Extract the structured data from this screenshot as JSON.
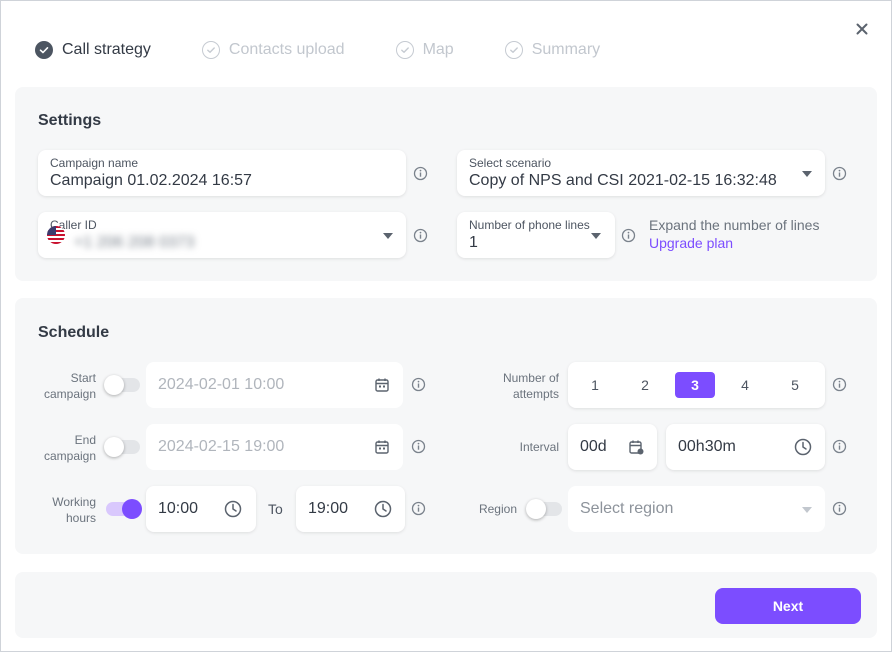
{
  "stepper": {
    "steps": [
      {
        "label": "Call strategy",
        "state": "done"
      },
      {
        "label": "Contacts upload",
        "state": "todo"
      },
      {
        "label": "Map",
        "state": "todo"
      },
      {
        "label": "Summary",
        "state": "todo"
      }
    ]
  },
  "settings": {
    "title": "Settings",
    "campaign_name": {
      "label": "Campaign name",
      "value": "Campaign 01.02.2024 16:57"
    },
    "scenario": {
      "label": "Select scenario",
      "value": "Copy of NPS and CSI 2021-02-15 16:32:48"
    },
    "caller_id": {
      "label": "Caller ID",
      "value": "+1 206 208 0373",
      "flag": "us-flag-icon"
    },
    "phone_lines": {
      "label": "Number of phone lines",
      "value": "1"
    },
    "expand_text": "Expand the number of lines",
    "upgrade_link": "Upgrade plan"
  },
  "schedule": {
    "title": "Schedule",
    "start_campaign": {
      "label_line1": "Start",
      "label_line2": "campaign",
      "enabled": false,
      "value": "2024-02-01 10:00"
    },
    "end_campaign": {
      "label_line1": "End",
      "label_line2": "campaign",
      "enabled": false,
      "value": "2024-02-15 19:00"
    },
    "working_hours": {
      "label_line1": "Working",
      "label_line2": "hours",
      "enabled": true,
      "from": "10:00",
      "to_label": "To",
      "to": "19:00"
    },
    "attempts": {
      "label_line1": "Number of",
      "label_line2": "attempts",
      "options": [
        "1",
        "2",
        "3",
        "4",
        "5"
      ],
      "selected": "3"
    },
    "interval": {
      "label": "Interval",
      "days": "00d",
      "time": "00h30m"
    },
    "region": {
      "label": "Region",
      "enabled": false,
      "placeholder": "Select region"
    }
  },
  "footer": {
    "next_label": "Next"
  },
  "colors": {
    "accent": "#7c4dff",
    "panel": "#f6f7f8",
    "text": "#333a45"
  }
}
